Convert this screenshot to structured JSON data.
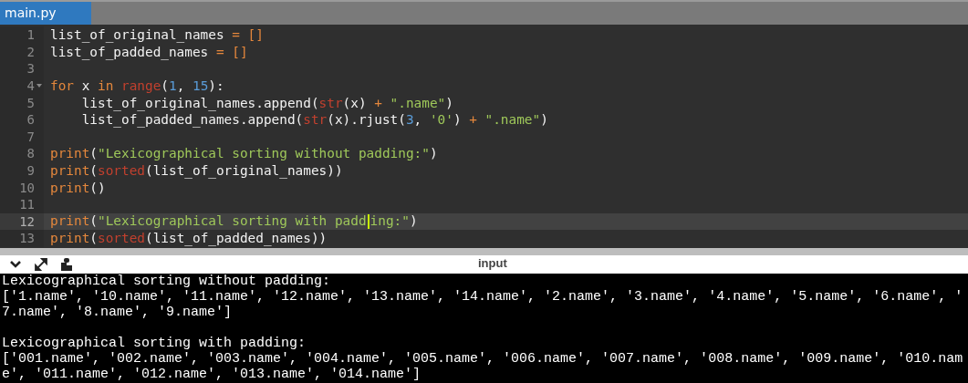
{
  "tabs": [
    {
      "label": "main.py",
      "selected": true
    }
  ],
  "editor": {
    "lines": [
      {
        "number": "1",
        "foldable": false,
        "active": false,
        "tokens": [
          {
            "kind": "plain",
            "text": "list_of_original_names "
          },
          {
            "kind": "op",
            "text": "= []"
          }
        ]
      },
      {
        "number": "2",
        "foldable": false,
        "active": false,
        "tokens": [
          {
            "kind": "plain",
            "text": "list_of_padded_names "
          },
          {
            "kind": "op",
            "text": "= []"
          }
        ]
      },
      {
        "number": "3",
        "foldable": false,
        "active": false
      },
      {
        "number": "4",
        "foldable": true,
        "active": false,
        "tokens": [
          {
            "kind": "keyword",
            "text": "for"
          },
          {
            "kind": "plain",
            "text": " x "
          },
          {
            "kind": "keyword",
            "text": "in "
          },
          {
            "kind": "builtin",
            "text": "range"
          },
          {
            "kind": "plain",
            "text": "("
          },
          {
            "kind": "number",
            "text": "1"
          },
          {
            "kind": "plain",
            "text": ", "
          },
          {
            "kind": "number",
            "text": "15"
          },
          {
            "kind": "plain",
            "text": "):"
          }
        ]
      },
      {
        "number": "5",
        "foldable": false,
        "active": false,
        "tokens": [
          {
            "kind": "plain",
            "text": "    list_of_original_names.append("
          },
          {
            "kind": "builtin",
            "text": "str"
          },
          {
            "kind": "plain",
            "text": "(x) "
          },
          {
            "kind": "op",
            "text": "+ "
          },
          {
            "kind": "string",
            "text": "\".name\""
          },
          {
            "kind": "plain",
            "text": ")"
          }
        ]
      },
      {
        "number": "6",
        "foldable": false,
        "active": false,
        "tokens": [
          {
            "kind": "plain",
            "text": "    list_of_padded_names.append("
          },
          {
            "kind": "builtin",
            "text": "str"
          },
          {
            "kind": "plain",
            "text": "(x).rjust("
          },
          {
            "kind": "number",
            "text": "3"
          },
          {
            "kind": "plain",
            "text": ", "
          },
          {
            "kind": "string",
            "text": "'0'"
          },
          {
            "kind": "plain",
            "text": ") "
          },
          {
            "kind": "op",
            "text": "+ "
          },
          {
            "kind": "string",
            "text": "\".name\""
          },
          {
            "kind": "plain",
            "text": ")"
          }
        ]
      },
      {
        "number": "7",
        "foldable": false,
        "active": false
      },
      {
        "number": "8",
        "foldable": false,
        "active": false,
        "tokens": [
          {
            "kind": "keyword",
            "text": "print"
          },
          {
            "kind": "plain",
            "text": "("
          },
          {
            "kind": "string",
            "text": "\"Lexicographical sorting without padding:\""
          },
          {
            "kind": "plain",
            "text": ")"
          }
        ]
      },
      {
        "number": "9",
        "foldable": false,
        "active": false,
        "tokens": [
          {
            "kind": "keyword",
            "text": "print"
          },
          {
            "kind": "plain",
            "text": "("
          },
          {
            "kind": "builtin",
            "text": "sorted"
          },
          {
            "kind": "plain",
            "text": "(list_of_original_names))"
          }
        ]
      },
      {
        "number": "10",
        "foldable": false,
        "active": false,
        "tokens": [
          {
            "kind": "keyword",
            "text": "print"
          },
          {
            "kind": "plain",
            "text": "()"
          }
        ]
      },
      {
        "number": "11",
        "foldable": false,
        "active": false
      },
      {
        "number": "12",
        "foldable": false,
        "active": true,
        "tokens": [
          {
            "kind": "keyword",
            "text": "print"
          },
          {
            "kind": "plain",
            "text": "("
          },
          {
            "kind": "string",
            "text": "\"Lexicographical sorting with padd"
          },
          {
            "kind": "string",
            "text": "ing:\"",
            "caret_before": true
          },
          {
            "kind": "plain",
            "text": ")"
          }
        ]
      },
      {
        "number": "13",
        "foldable": false,
        "active": false,
        "tokens": [
          {
            "kind": "keyword",
            "text": "print"
          },
          {
            "kind": "plain",
            "text": "("
          },
          {
            "kind": "builtin",
            "text": "sorted"
          },
          {
            "kind": "plain",
            "text": "(list_of_padded_names))"
          }
        ]
      }
    ]
  },
  "console": {
    "title": "input",
    "blocks": [
      [
        "Lexicographical sorting without padding:",
        "['1.name', '10.name', '11.name', '12.name', '13.name', '14.name', '2.name', '3.name', '4.name', '5.name', '6.name', '",
        "7.name', '8.name', '9.name']"
      ],
      [
        "Lexicographical sorting with padding:",
        "['001.name', '002.name', '003.name', '004.name', '005.name', '006.name', '007.name', '008.name', '009.name', '010.nam",
        "e', '011.name', '012.name', '013.name', '014.name']"
      ]
    ]
  }
}
